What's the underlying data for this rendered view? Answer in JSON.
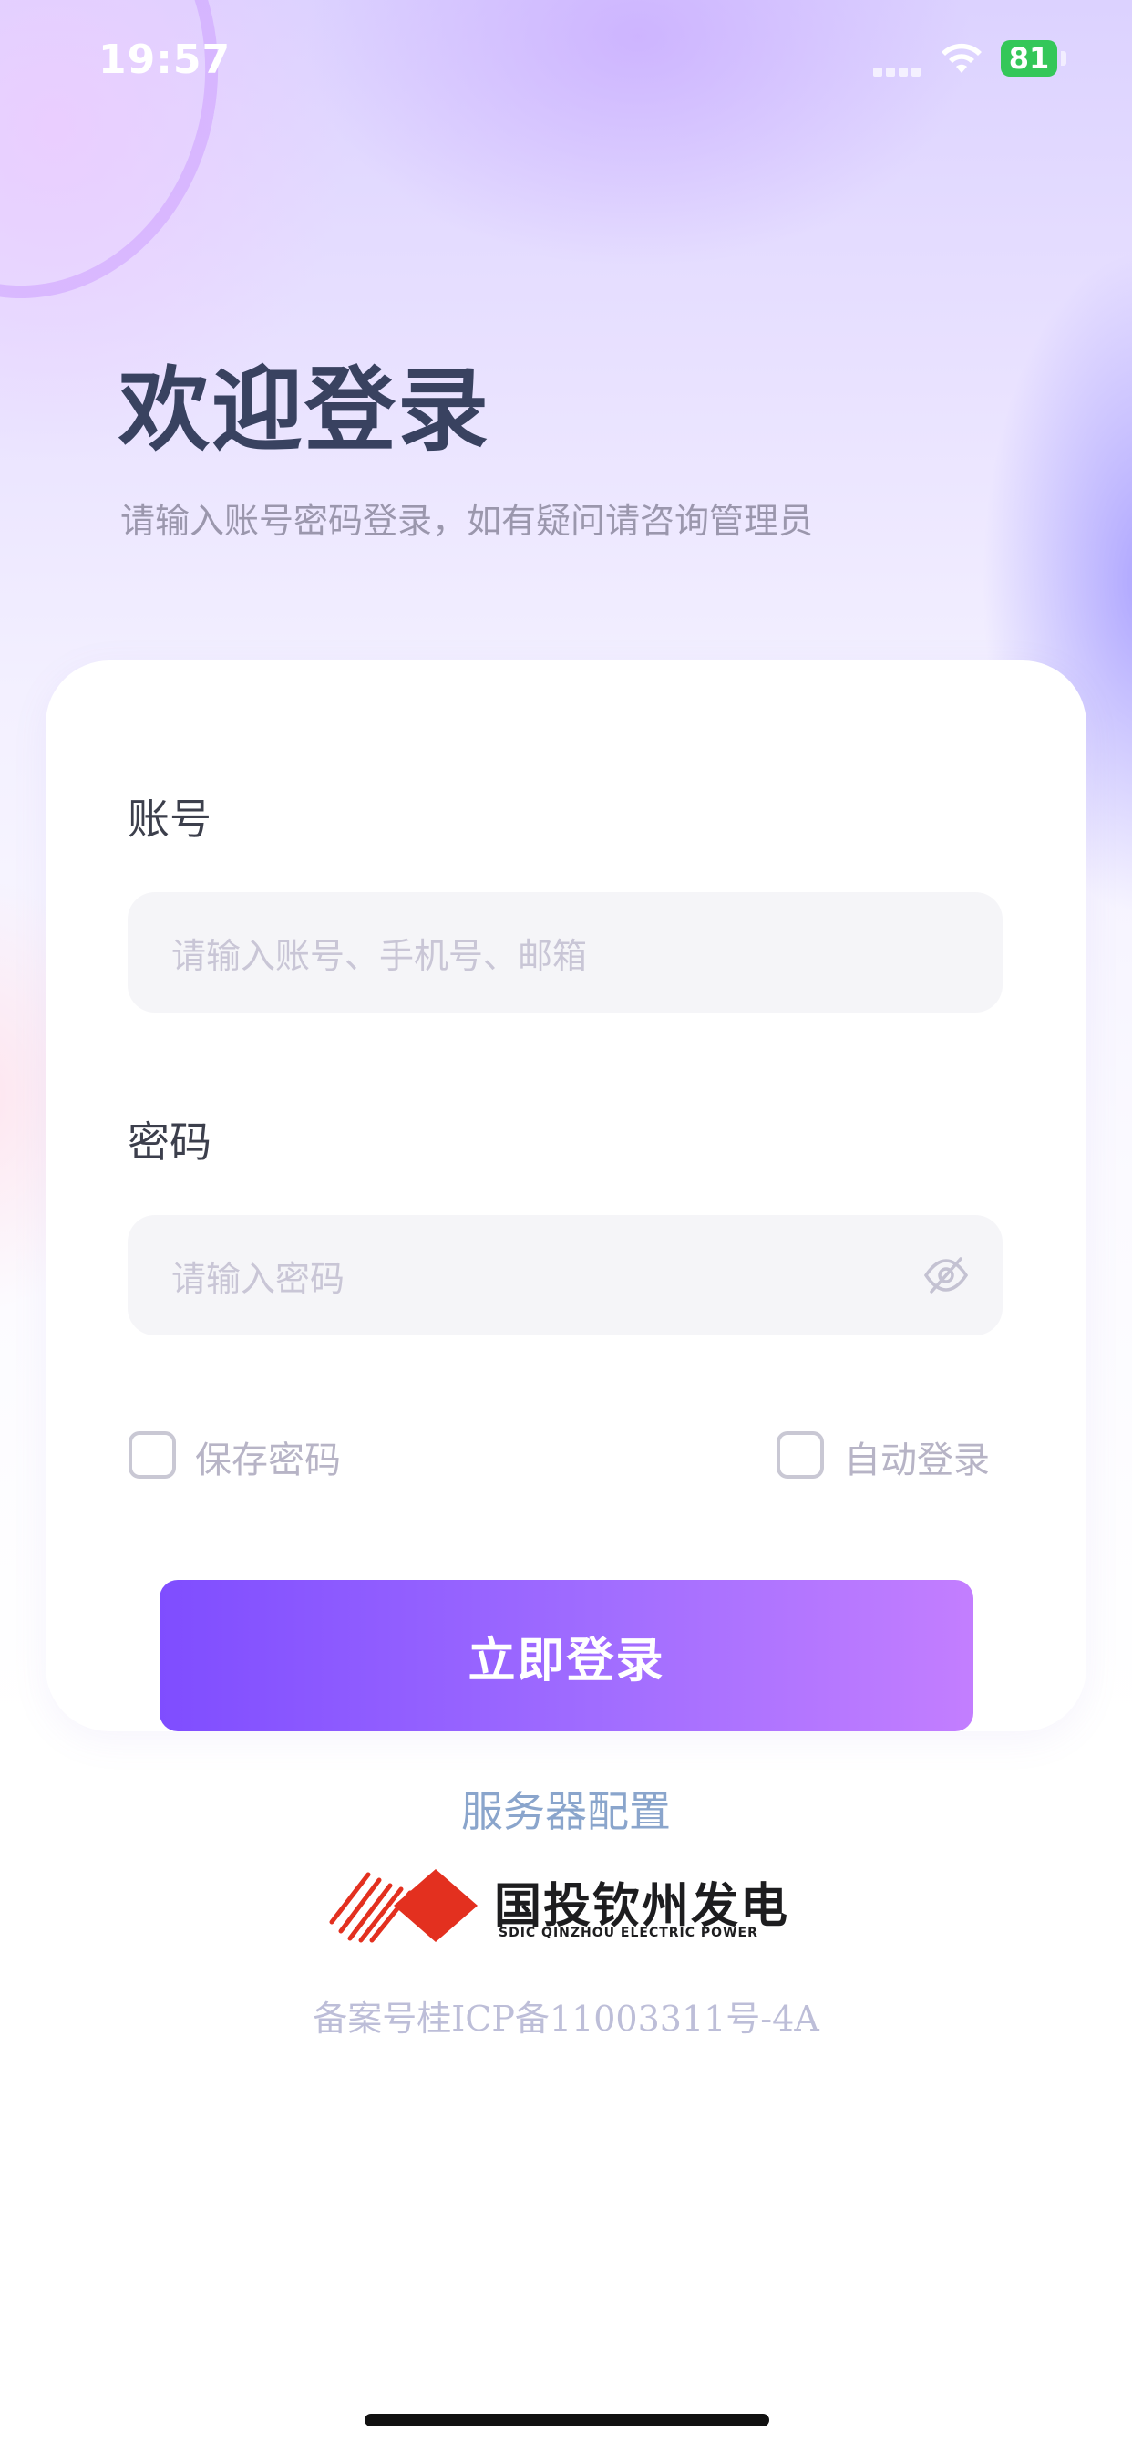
{
  "status_bar": {
    "time": "19:57",
    "battery": "81"
  },
  "header": {
    "title": "欢迎登录",
    "subtitle": "请输入账号密码登录，如有疑问请咨询管理员"
  },
  "form": {
    "account_label": "账号",
    "account_placeholder": "请输入账号、手机号、邮箱",
    "password_label": "密码",
    "password_placeholder": "请输入密码",
    "save_password_label": "保存密码",
    "auto_login_label": "自动登录",
    "login_button": "立即登录"
  },
  "footer": {
    "server_config": "服务器配置",
    "logo_cn": "国投钦州发电",
    "logo_en": "SDIC QINZHOU ELECTRIC POWER",
    "icp": "备案号桂ICP备11003311号-4A"
  },
  "colors": {
    "accent_start": "#7f4dff",
    "accent_end": "#c37eff",
    "title": "#394260",
    "link": "#8aa5cc",
    "logo_red": "#e3301f"
  },
  "icons": [
    "wifi-icon",
    "battery-icon",
    "eye-off-icon",
    "logo-icon"
  ]
}
